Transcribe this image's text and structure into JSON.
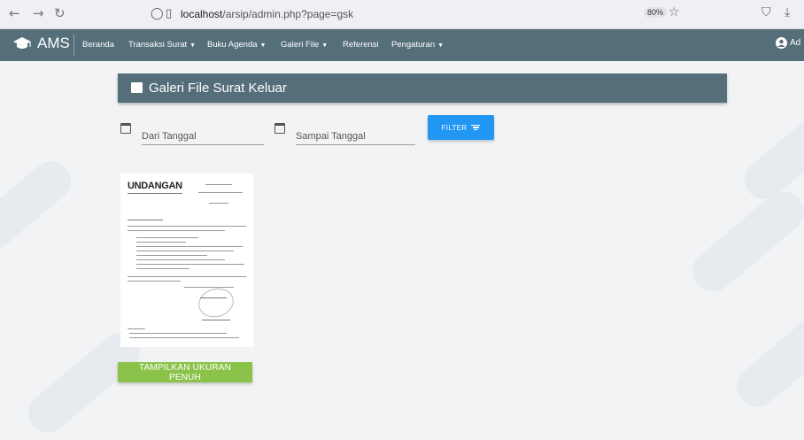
{
  "browser": {
    "url_host": "localhost",
    "url_path": "/arsip/admin.php?page=gsk",
    "zoom": "80%"
  },
  "app": {
    "brand": "AMS",
    "nav": [
      {
        "label": "Beranda",
        "dropdown": false
      },
      {
        "label": "Transaksi Surat",
        "dropdown": true
      },
      {
        "label": "Buku Agenda",
        "dropdown": true
      },
      {
        "label": "Galeri File",
        "dropdown": true
      },
      {
        "label": "Referensi",
        "dropdown": false
      },
      {
        "label": "Pengaturan",
        "dropdown": true
      }
    ],
    "user_label": "Ad"
  },
  "page": {
    "title": "Galeri File Surat Keluar",
    "from_date_placeholder": "Dari Tanggal",
    "to_date_placeholder": "Sampai Tanggal",
    "filter_label": "FILTER",
    "doc_heading": "UNDANGAN",
    "show_button": "TAMPILKAN UKURAN PENUH"
  },
  "colors": {
    "navbar": "#546e7a",
    "filter_button": "#2196f3",
    "show_button": "#8bc34a"
  }
}
